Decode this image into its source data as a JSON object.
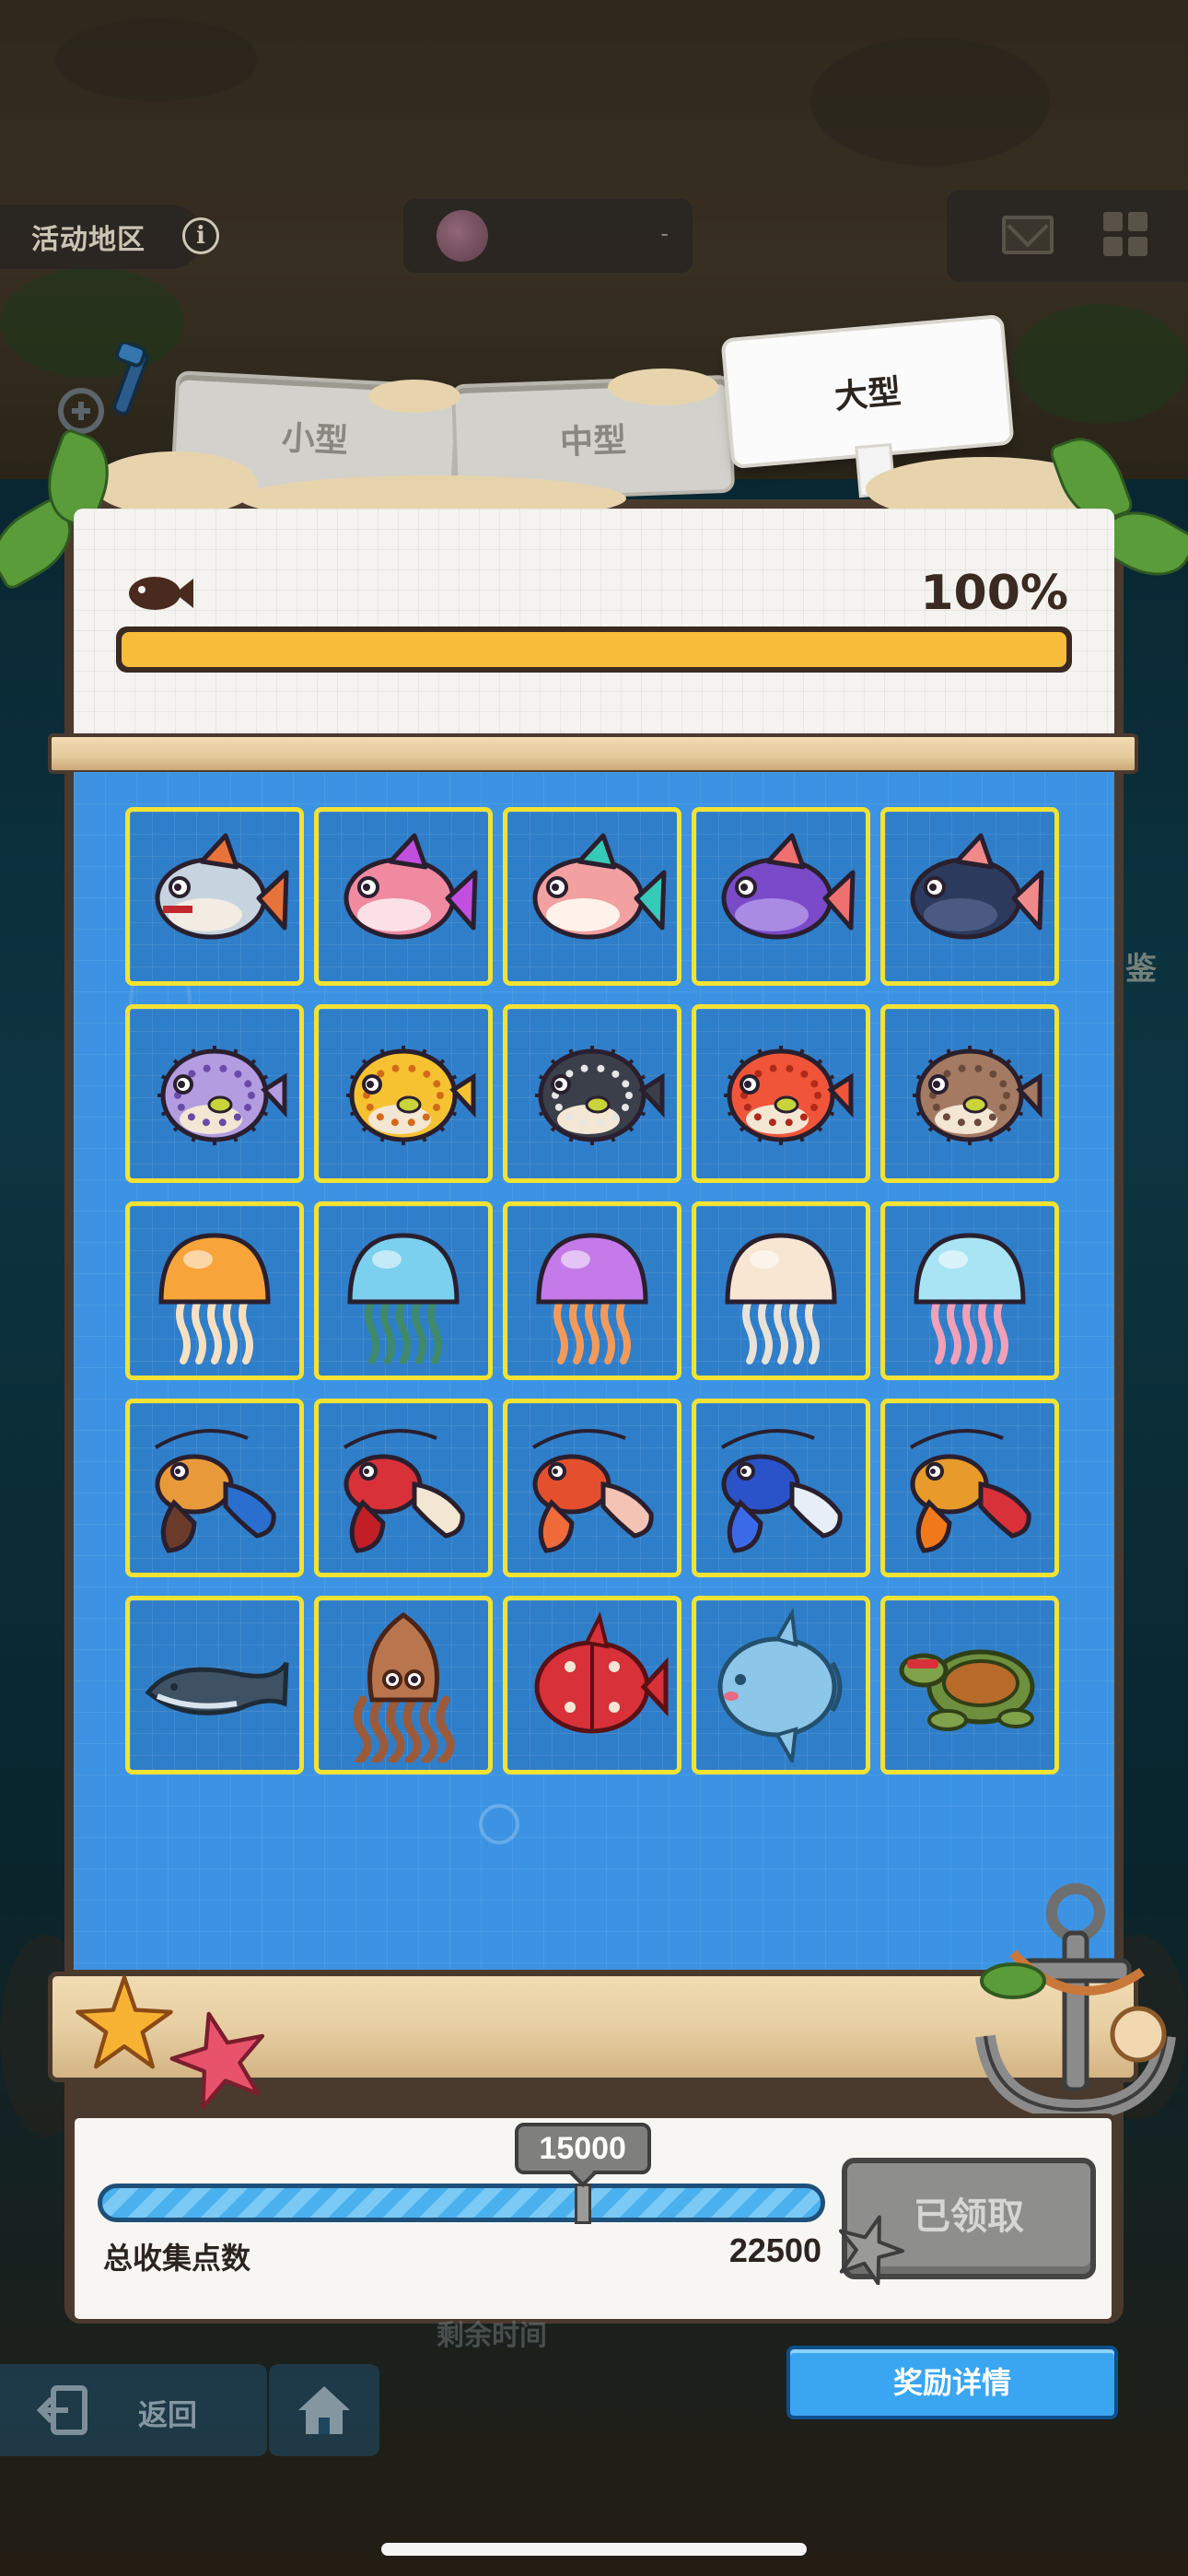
{
  "hud": {
    "region_label": "活动地区",
    "info_symbol": "i",
    "center_value": "-"
  },
  "tabs": {
    "small": "小型",
    "medium": "中型",
    "large": "大型",
    "selected": "大型"
  },
  "collection": {
    "percent_label": "100%",
    "progress": 1.0,
    "rows": [
      [
        "piranha",
        "pink-fish",
        "lionfish",
        "purple-fish",
        "dark-fish"
      ],
      [
        "purple-pufferfish",
        "yellow-pufferfish",
        "black-pufferfish",
        "red-pufferfish",
        "brown-pufferfish"
      ],
      [
        "orange-jellyfish",
        "blue-jellyfish",
        "purple-jellyfish",
        "white-jellyfish",
        "cyan-jellyfish"
      ],
      [
        "orange-lobster",
        "red-lobster",
        "red-shrimp",
        "blue-lobster",
        "gold-lobster"
      ],
      [
        "whale",
        "giant-squid",
        "red-pufferfish-large",
        "sunfish",
        "sea-turtle"
      ]
    ]
  },
  "reward": {
    "milestone": "15000",
    "milestone_fraction": 0.6667,
    "points_label": "总收集点数",
    "points_total": "22500",
    "claimed_label": "已领取",
    "detail_button": "奖励详情"
  },
  "bottom": {
    "back_label": "返回",
    "timer_label": "剩余时间"
  },
  "side_text": [
    "鉴"
  ],
  "colors": {
    "progress_fill": "#f7bd3a",
    "cell_border": "#f2e233",
    "board_blue": "#3c93e3",
    "claimed_gray": "#8e8e8c",
    "detail_blue": "#3aa6f2"
  }
}
